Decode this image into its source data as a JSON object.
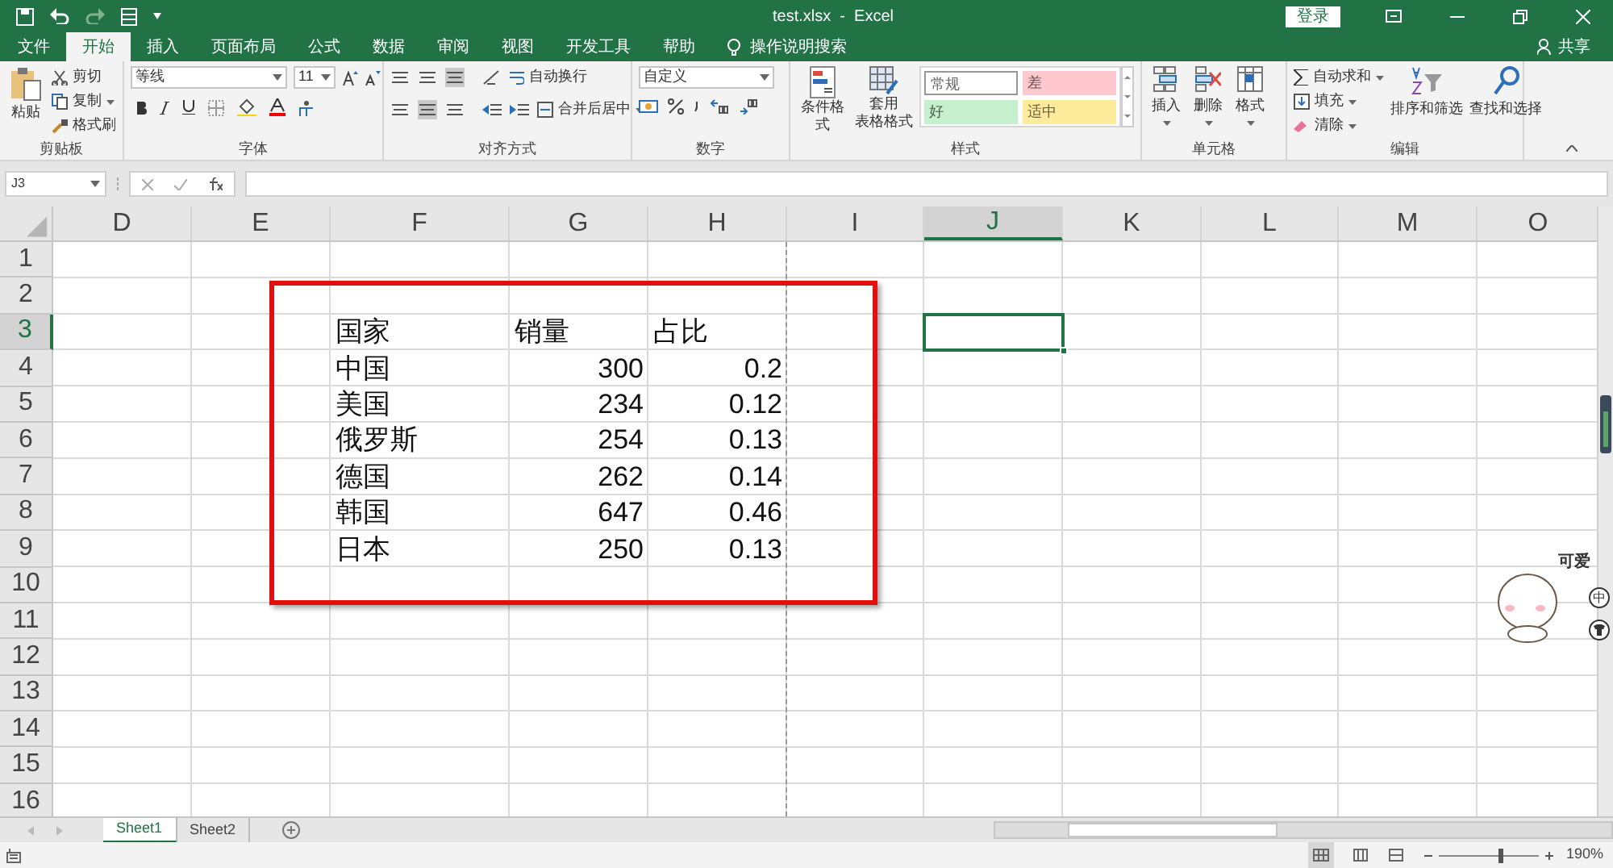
{
  "title_bar": {
    "title": "test.xlsx  -  Excel",
    "login": "登录"
  },
  "menu_tabs": [
    {
      "label": "文件",
      "selected": false
    },
    {
      "label": "开始",
      "selected": true
    },
    {
      "label": "插入",
      "selected": false
    },
    {
      "label": "页面布局",
      "selected": false
    },
    {
      "label": "公式",
      "selected": false
    },
    {
      "label": "数据",
      "selected": false
    },
    {
      "label": "审阅",
      "selected": false
    },
    {
      "label": "视图",
      "selected": false
    },
    {
      "label": "开发工具",
      "selected": false
    },
    {
      "label": "帮助",
      "selected": false
    }
  ],
  "tell_me": "操作说明搜索",
  "share": "共享",
  "ribbon": {
    "clipboard": {
      "paste": "粘贴",
      "items": [
        "剪切",
        "复制",
        "格式刷"
      ],
      "label": "剪贴板"
    },
    "font": {
      "font_name": "等线",
      "font_size": "11",
      "label": "字体"
    },
    "alignment": {
      "wrap": "自动换行",
      "merge": "合并后居中",
      "label": "对齐方式"
    },
    "number": {
      "format": "自定义",
      "label": "数字"
    },
    "styles": {
      "conditional": "条件格式",
      "table_lines": [
        "套用",
        "表格格式"
      ],
      "label": "样式",
      "cell_styles": [
        {
          "text": "常规",
          "color": "#ffffff"
        },
        {
          "text": "差",
          "color": "#ffc7ce"
        },
        {
          "text": "好",
          "color": "#c6efce"
        },
        {
          "text": "适中",
          "color": "#ffeb9c"
        }
      ]
    },
    "cells": {
      "buttons": [
        "插入",
        "删除",
        "格式"
      ],
      "label": "单元格"
    },
    "editing": {
      "autosum": "自动求和",
      "fill": "填充",
      "clear": "清除",
      "sort": "排序和筛选",
      "find": "查找和选择",
      "label": "编辑"
    }
  },
  "formula_bar": {
    "name_box": "J3"
  },
  "grid": {
    "columns": [
      {
        "label": "D",
        "selected": false
      },
      {
        "label": "E",
        "selected": false
      },
      {
        "label": "F",
        "selected": false
      },
      {
        "label": "G",
        "selected": false
      },
      {
        "label": "H",
        "selected": false
      },
      {
        "label": "I",
        "selected": false
      },
      {
        "label": "J",
        "selected": true
      },
      {
        "label": "K",
        "selected": false
      },
      {
        "label": "L",
        "selected": false
      },
      {
        "label": "M",
        "selected": false
      },
      {
        "label": "O",
        "selected": false
      }
    ],
    "rows": [
      {
        "label": "1",
        "selected": false
      },
      {
        "label": "2",
        "selected": false
      },
      {
        "label": "3",
        "selected": true
      },
      {
        "label": "4",
        "selected": false
      },
      {
        "label": "5",
        "selected": false
      },
      {
        "label": "6",
        "selected": false
      },
      {
        "label": "7",
        "selected": false
      },
      {
        "label": "8",
        "selected": false
      },
      {
        "label": "9",
        "selected": false
      },
      {
        "label": "10",
        "selected": false
      },
      {
        "label": "11",
        "selected": false
      },
      {
        "label": "12",
        "selected": false
      },
      {
        "label": "13",
        "selected": false
      },
      {
        "label": "14",
        "selected": false
      },
      {
        "label": "15",
        "selected": false
      },
      {
        "label": "16",
        "selected": false
      }
    ],
    "table": {
      "header": [
        "国家",
        "销量",
        "占比"
      ],
      "rows": [
        [
          "中国",
          "300",
          "0.2"
        ],
        [
          "美国",
          "234",
          "0.12"
        ],
        [
          "俄罗斯",
          "254",
          "0.13"
        ],
        [
          "德国",
          "262",
          "0.14"
        ],
        [
          "韩国",
          "647",
          "0.46"
        ],
        [
          "日本",
          "250",
          "0.13"
        ]
      ]
    },
    "highlight_box": {
      "kind": "rectangle"
    }
  },
  "sheet_tabs": [
    {
      "label": "Sheet1",
      "selected": true
    },
    {
      "label": "Sheet2",
      "selected": false
    }
  ],
  "status_bar": {
    "zoom": "190%",
    "zoom_slider": {
      "level": 0.62
    }
  },
  "ime_widget": {
    "caption": "可爱",
    "mode": "中"
  }
}
